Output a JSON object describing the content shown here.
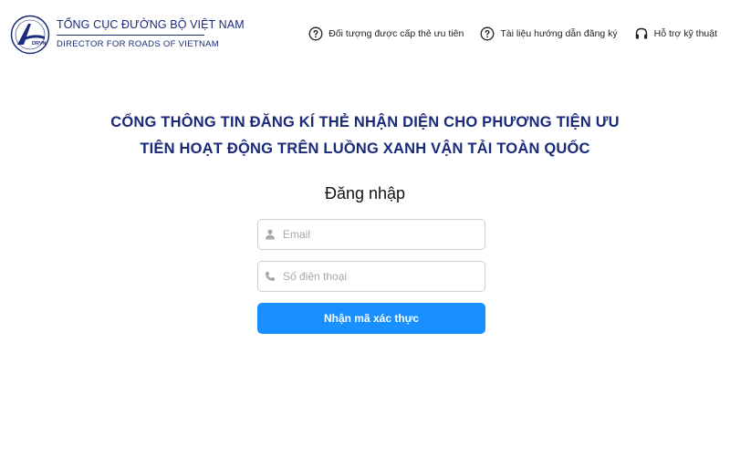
{
  "header": {
    "logo_text": "DRVN",
    "org_name": "TỔNG CỤC ĐƯỜNG BỘ VIỆT NAM",
    "org_sub": "DIRECTOR FOR ROADS OF VIETNAM",
    "nav": [
      {
        "label": "Đối tượng được cấp thẻ ưu tiên",
        "icon": "question-circle-icon"
      },
      {
        "label": "Tài liệu hướng dẫn đăng ký",
        "icon": "question-circle-icon"
      },
      {
        "label": "Hỗ trợ kỹ thuật",
        "icon": "headset-icon"
      }
    ]
  },
  "main": {
    "title_line1": "CỔNG THÔNG TIN ĐĂNG KÍ THẺ NHẬN DIỆN CHO PHƯƠNG TIỆN ƯU",
    "title_line2": "TIÊN HOẠT ĐỘNG TRÊN LUỒNG XANH VẬN TẢI TOÀN QUỐC",
    "login_title": "Đăng nhập",
    "email_placeholder": "Email",
    "email_value": "",
    "phone_placeholder": "Số điện thoại",
    "phone_value": "",
    "submit_label": "Nhận mã xác thực"
  },
  "colors": {
    "brand": "#1a2a7a",
    "primary_button": "#1890ff"
  }
}
